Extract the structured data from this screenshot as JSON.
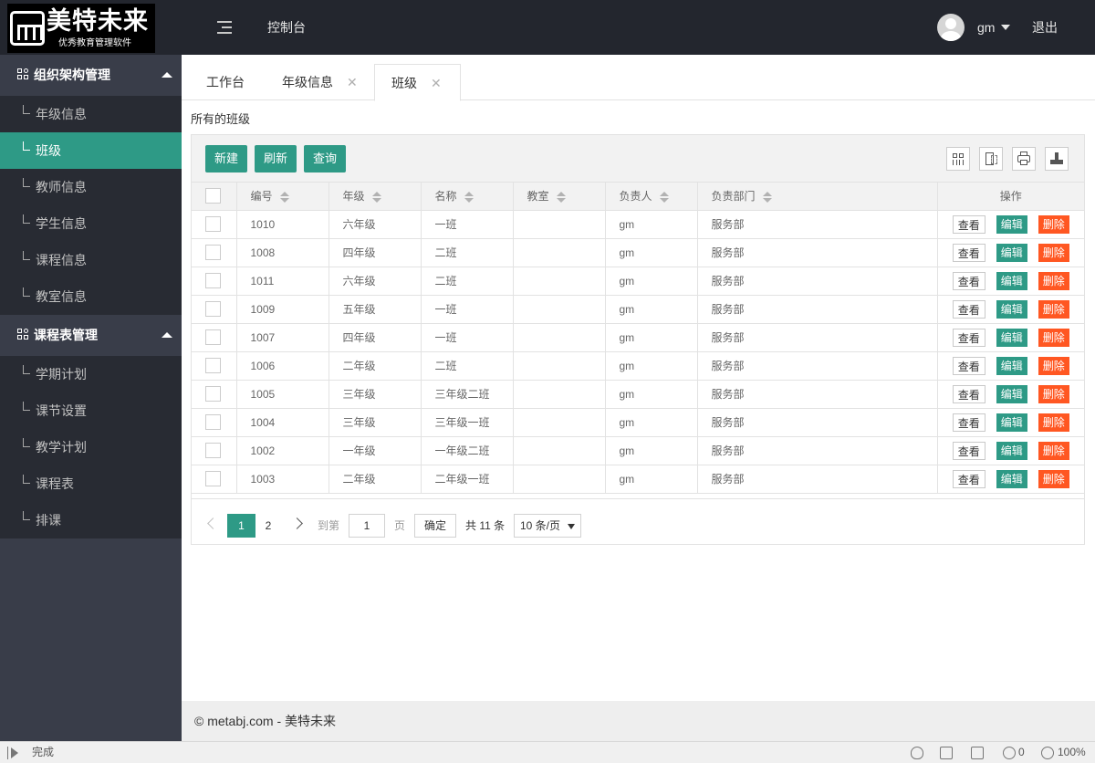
{
  "header": {
    "logo_title": "美特未来",
    "logo_subtitle": "优秀教育管理软件",
    "nav_console": "控制台",
    "username": "gm",
    "logout": "退出"
  },
  "sidebar": {
    "groups": [
      {
        "label": "组织架构管理",
        "items": [
          {
            "label": "年级信息",
            "active": false
          },
          {
            "label": "班级",
            "active": true
          },
          {
            "label": "教师信息",
            "active": false
          },
          {
            "label": "学生信息",
            "active": false
          },
          {
            "label": "课程信息",
            "active": false
          },
          {
            "label": "教室信息",
            "active": false
          }
        ]
      },
      {
        "label": "课程表管理",
        "items": [
          {
            "label": "学期计划",
            "active": false
          },
          {
            "label": "课节设置",
            "active": false
          },
          {
            "label": "教学计划",
            "active": false
          },
          {
            "label": "课程表",
            "active": false
          },
          {
            "label": "排课",
            "active": false
          }
        ]
      }
    ]
  },
  "tabs": [
    {
      "label": "工作台",
      "closable": false,
      "active": false
    },
    {
      "label": "年级信息",
      "closable": true,
      "active": false
    },
    {
      "label": "班级",
      "closable": true,
      "active": true
    }
  ],
  "page": {
    "section_title": "所有的班级"
  },
  "toolbar": {
    "new_label": "新建",
    "refresh_label": "刷新",
    "query_label": "查询",
    "right_icons": [
      "columns-filter-icon",
      "export-icon",
      "print-icon",
      "import-icon"
    ]
  },
  "table": {
    "columns": [
      "编号",
      "年级",
      "名称",
      "教室",
      "负责人",
      "负责部门",
      "操作"
    ],
    "rows": [
      {
        "id": "1010",
        "grade": "六年级",
        "name": "一班",
        "room": "",
        "owner": "gm",
        "dept": "服务部"
      },
      {
        "id": "1008",
        "grade": "四年级",
        "name": "二班",
        "room": "",
        "owner": "gm",
        "dept": "服务部"
      },
      {
        "id": "1011",
        "grade": "六年级",
        "name": "二班",
        "room": "",
        "owner": "gm",
        "dept": "服务部"
      },
      {
        "id": "1009",
        "grade": "五年级",
        "name": "一班",
        "room": "",
        "owner": "gm",
        "dept": "服务部"
      },
      {
        "id": "1007",
        "grade": "四年级",
        "name": "一班",
        "room": "",
        "owner": "gm",
        "dept": "服务部"
      },
      {
        "id": "1006",
        "grade": "二年级",
        "name": "二班",
        "room": "",
        "owner": "gm",
        "dept": "服务部"
      },
      {
        "id": "1005",
        "grade": "三年级",
        "name": "三年级二班",
        "room": "",
        "owner": "gm",
        "dept": "服务部"
      },
      {
        "id": "1004",
        "grade": "三年级",
        "name": "三年级一班",
        "room": "",
        "owner": "gm",
        "dept": "服务部"
      },
      {
        "id": "1002",
        "grade": "一年级",
        "name": "一年级二班",
        "room": "",
        "owner": "gm",
        "dept": "服务部"
      },
      {
        "id": "1003",
        "grade": "二年级",
        "name": "二年级一班",
        "room": "",
        "owner": "gm",
        "dept": "服务部"
      }
    ],
    "row_actions": {
      "view": "查看",
      "edit": "编辑",
      "delete": "删除"
    }
  },
  "pagination": {
    "pages": [
      "1",
      "2"
    ],
    "current": "1",
    "goto_prefix": "到第",
    "goto_value": "1",
    "goto_suffix": "页",
    "confirm": "确定",
    "total": "共 11 条",
    "page_size": "10 条/页"
  },
  "footer": {
    "text": "© metabj.com - 美特未来"
  },
  "statusbar": {
    "status": "完成",
    "count": "0",
    "zoom": "100%"
  },
  "colors": {
    "accent": "#2e9a86",
    "danger": "#ff5722",
    "header_bg": "#23262e",
    "sidebar_bg": "#393d49"
  }
}
